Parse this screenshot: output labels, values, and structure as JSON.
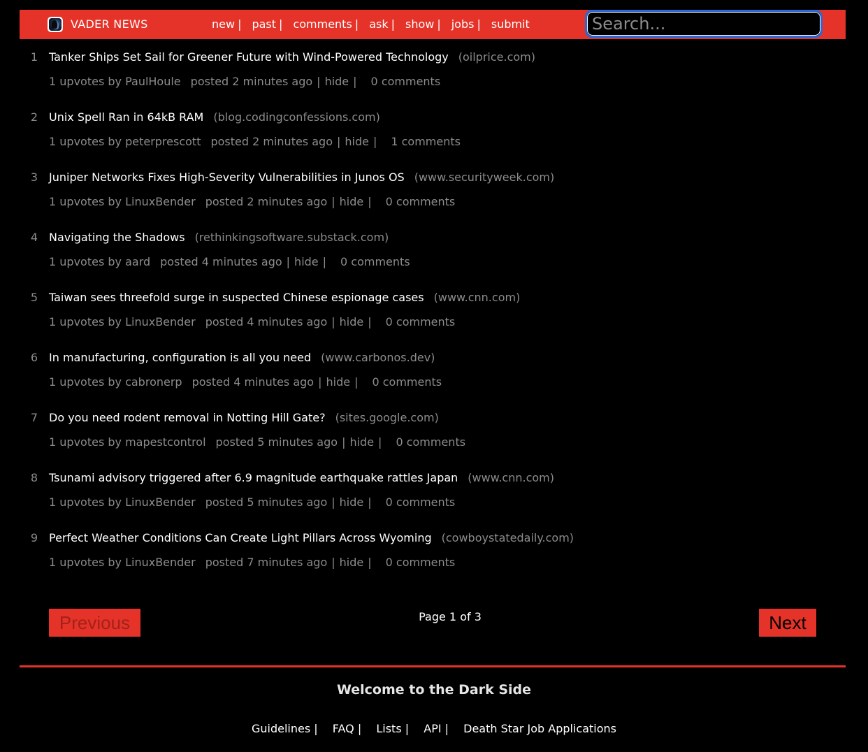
{
  "header": {
    "brand": "VADER NEWS",
    "logo_icon": "vader-helmet-icon",
    "nav": [
      "new",
      "past",
      "comments",
      "ask",
      "show",
      "jobs",
      "submit"
    ],
    "nav_separator": "|",
    "search_placeholder": "Search..."
  },
  "colors": {
    "accent": "#e53329",
    "background": "#000000",
    "muted_text": "#8c8c8c",
    "search_focus_ring": "#2e66d4"
  },
  "stories": [
    {
      "rank": "1",
      "title": "Tanker Ships Set Sail for Greener Future with Wind-Powered Technology",
      "domain": "(oilprice.com)",
      "upvotes": "1 upvotes by",
      "user": "PaulHoule",
      "posted": "posted 2 minutes ago",
      "hide": "hide",
      "comments": "0 comments"
    },
    {
      "rank": "2",
      "title": "Unix Spell Ran in 64kB RAM",
      "domain": "(blog.codingconfessions.com)",
      "upvotes": "1 upvotes by",
      "user": "peterprescott",
      "posted": "posted 2 minutes ago",
      "hide": "hide",
      "comments": "1 comments"
    },
    {
      "rank": "3",
      "title": "Juniper Networks Fixes High-Severity Vulnerabilities in Junos OS",
      "domain": "(www.securityweek.com)",
      "upvotes": "1 upvotes by",
      "user": "LinuxBender",
      "posted": "posted 2 minutes ago",
      "hide": "hide",
      "comments": "0 comments"
    },
    {
      "rank": "4",
      "title": "Navigating the Shadows",
      "domain": "(rethinkingsoftware.substack.com)",
      "upvotes": "1 upvotes by",
      "user": "aard",
      "posted": "posted 4 minutes ago",
      "hide": "hide",
      "comments": "0 comments"
    },
    {
      "rank": "5",
      "title": "Taiwan sees threefold surge in suspected Chinese espionage cases",
      "domain": "(www.cnn.com)",
      "upvotes": "1 upvotes by",
      "user": "LinuxBender",
      "posted": "posted 4 minutes ago",
      "hide": "hide",
      "comments": "0 comments"
    },
    {
      "rank": "6",
      "title": "In manufacturing, configuration is all you need",
      "domain": "(www.carbonos.dev)",
      "upvotes": "1 upvotes by",
      "user": "cabronerp",
      "posted": "posted 4 minutes ago",
      "hide": "hide",
      "comments": "0 comments"
    },
    {
      "rank": "7",
      "title": "Do you need rodent removal in Notting Hill Gate?",
      "domain": "(sites.google.com)",
      "upvotes": "1 upvotes by",
      "user": "mapestcontrol",
      "posted": "posted 5 minutes ago",
      "hide": "hide",
      "comments": "0 comments"
    },
    {
      "rank": "8",
      "title": "Tsunami advisory triggered after 6.9 magnitude earthquake rattles Japan",
      "domain": "(www.cnn.com)",
      "upvotes": "1 upvotes by",
      "user": "LinuxBender",
      "posted": "posted 5 minutes ago",
      "hide": "hide",
      "comments": "0 comments"
    },
    {
      "rank": "9",
      "title": "Perfect Weather Conditions Can Create Light Pillars Across Wyoming",
      "domain": "(cowboystatedaily.com)",
      "upvotes": "1 upvotes by",
      "user": "LinuxBender",
      "posted": "posted 7 minutes ago",
      "hide": "hide",
      "comments": "0 comments"
    }
  ],
  "pagination": {
    "previous": "Previous",
    "page_info": "Page 1 of 3",
    "next": "Next"
  },
  "footer": {
    "title": "Welcome to the Dark Side",
    "links": [
      "Guidelines",
      "FAQ",
      "Lists",
      "API",
      "Death Star Job Applications"
    ],
    "separator": "|"
  }
}
